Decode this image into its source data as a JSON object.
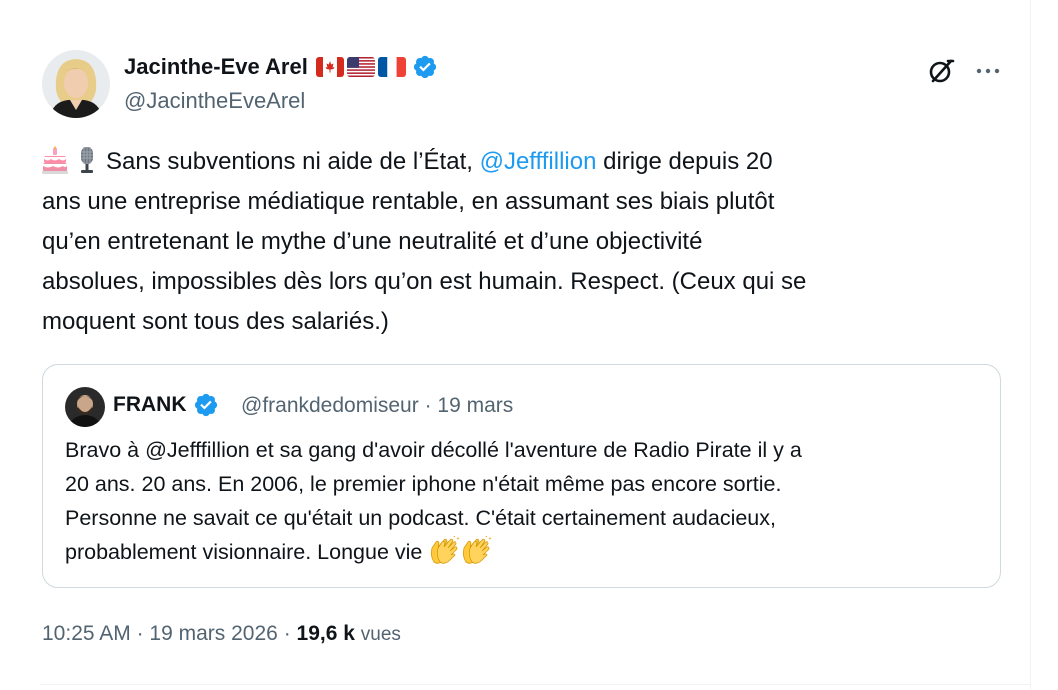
{
  "author": {
    "name": "Jacinthe-Eve Arel",
    "handle": "@JacintheEveArel",
    "flags": [
      "canada-flag",
      "usa-flag",
      "france-flag"
    ],
    "verified": true
  },
  "tweet": {
    "emoji": [
      "birthday-cake-icon",
      "microphone-icon"
    ],
    "lines": [
      {
        "before": "Sans subventions ni aide de l’État, ",
        "mention": "@Jefffillion",
        "after": " dirige depuis 20"
      },
      "ans une entreprise médiatique rentable, en assumant ses biais plutôt",
      "qu’en entretenant le mythe d’une neutralité et d’une objectivité",
      "absolues, impossibles dès lors qu’on est humain. Respect. (Ceux qui se",
      "moquent sont tous des salariés.)"
    ]
  },
  "quote": {
    "name": "FRANK",
    "handle": "@frankdedomiseur",
    "date": "19 mars",
    "lines": [
      "Bravo à @Jefffillion et sa gang d'avoir décollé l'aventure de Radio Pirate il y a",
      "20 ans. 20 ans. En 2006, le premier iphone n'était même pas encore sortie.",
      "Personne ne savait ce qu'était un podcast. C'était certainement audacieux,",
      "probablement visionnaire. Longue vie "
    ],
    "end_emoji": [
      "clapping-hands-icon",
      "clapping-hands-icon"
    ]
  },
  "footer": {
    "time": "10:25 AM",
    "date": "19 mars 2026",
    "views_count": "19,6 k",
    "views_label": "vues",
    "separator": "·"
  },
  "colors": {
    "link": "#1d9bf0",
    "secondary": "#536471",
    "text": "#0f1419",
    "border": "#cfd9de",
    "verified": "#1d9bf0"
  }
}
